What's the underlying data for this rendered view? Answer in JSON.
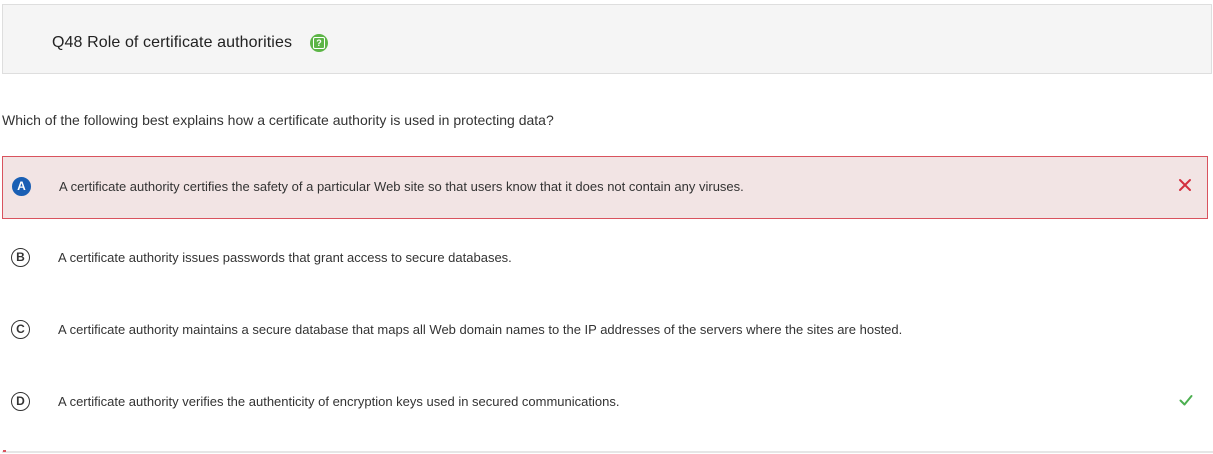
{
  "header": {
    "title": "Q48 Role of certificate authorities",
    "help_icon": "help-question-icon",
    "help_icon_color": "#5cb546"
  },
  "question": "Which of the following best explains how a certificate authority is used in protecting data?",
  "options": [
    {
      "letter": "A",
      "text": "A certificate authority certifies the safety of a particular Web site so that users know that it does not contain any viruses.",
      "selected": true,
      "status": "incorrect",
      "status_icon": "x-icon"
    },
    {
      "letter": "B",
      "text": "A certificate authority issues passwords that grant access to secure databases.",
      "selected": false,
      "status": "none"
    },
    {
      "letter": "C",
      "text": "A certificate authority maintains a secure database that maps all Web domain names to the IP addresses of the servers where the sites are hosted.",
      "selected": false,
      "status": "none"
    },
    {
      "letter": "D",
      "text": "A certificate authority verifies the authenticity of encryption keys used in secured communications.",
      "selected": false,
      "status": "correct",
      "status_icon": "checkmark-icon"
    }
  ],
  "colors": {
    "selected_letter": "#1a5fb4",
    "incorrect_bg": "#f2e4e4",
    "incorrect_border": "#d9535e",
    "incorrect_mark": "#d32f3f",
    "correct_mark": "#4caf50"
  }
}
